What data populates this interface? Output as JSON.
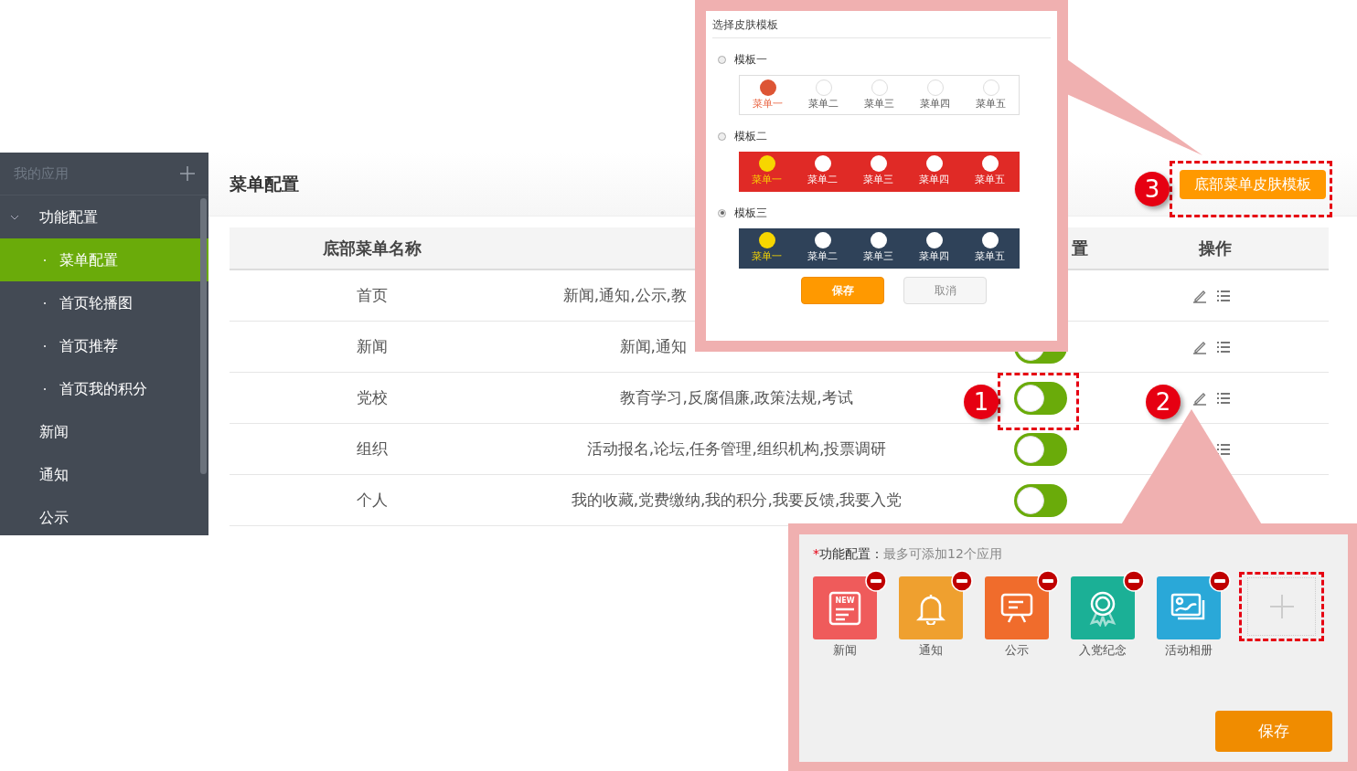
{
  "sidebar": {
    "header": "我的应用",
    "items": [
      {
        "label": "功能配置",
        "expanded": true,
        "children": [
          {
            "label": "菜单配置",
            "selected": true
          },
          {
            "label": "首页轮播图",
            "selected": false
          },
          {
            "label": "首页推荐",
            "selected": false
          },
          {
            "label": "首页我的积分",
            "selected": false
          }
        ]
      },
      {
        "label": "新闻",
        "selected": false
      },
      {
        "label": "通知",
        "selected": false
      },
      {
        "label": "公示",
        "selected": false
      }
    ]
  },
  "page": {
    "title": "菜单配置",
    "skin_button": "底部菜单皮肤模板"
  },
  "table": {
    "columns": [
      "底部菜单名称",
      "置",
      "操作"
    ],
    "rows": [
      {
        "name": "首页",
        "apps": "新闻,通知,公示,教"
      },
      {
        "name": "新闻",
        "apps": "新闻,通知",
        "on": false
      },
      {
        "name": "党校",
        "apps": "教育学习,反腐倡廉,政策法规,考试",
        "on": false
      },
      {
        "name": "组织",
        "apps": "活动报名,论坛,任务管理,组织机构,投票调研",
        "on": false
      },
      {
        "name": "个人",
        "apps": "我的收藏,党费缴纳,我的积分,我要反馈,我要入党",
        "on": false
      }
    ]
  },
  "callouts": [
    "1",
    "2",
    "3"
  ],
  "skin_dialog": {
    "title": "选择皮肤模板",
    "templates": [
      {
        "label": "模板一",
        "selected": false,
        "kind": "plain",
        "items": [
          {
            "label": "菜单一",
            "selected": true
          },
          {
            "label": "菜单二",
            "selected": false
          },
          {
            "label": "菜单三",
            "selected": false
          },
          {
            "label": "菜单四",
            "selected": false
          },
          {
            "label": "菜单五",
            "selected": false
          }
        ]
      },
      {
        "label": "模板二",
        "selected": false,
        "kind": "red",
        "items": [
          {
            "label": "菜单一",
            "selected": true
          },
          {
            "label": "菜单二",
            "selected": false
          },
          {
            "label": "菜单三",
            "selected": false
          },
          {
            "label": "菜单四",
            "selected": false
          },
          {
            "label": "菜单五",
            "selected": false
          }
        ]
      },
      {
        "label": "模板三",
        "selected": true,
        "kind": "navy",
        "items": [
          {
            "label": "菜单一",
            "selected": true
          },
          {
            "label": "菜单二",
            "selected": false
          },
          {
            "label": "菜单三",
            "selected": false
          },
          {
            "label": "菜单四",
            "selected": false
          },
          {
            "label": "菜单五",
            "selected": false
          }
        ]
      }
    ],
    "save": "保存",
    "cancel": "取消"
  },
  "app_panel": {
    "asterisk": "*",
    "label": "功能配置：",
    "hint": "最多可添加12个应用",
    "apps": [
      {
        "label": "新闻",
        "kind": "news",
        "color": "#ef5b5b",
        "icon_text": "NEW"
      },
      {
        "label": "通知",
        "kind": "bell",
        "color": "#efa02f"
      },
      {
        "label": "公示",
        "kind": "board",
        "color": "#f06c2c"
      },
      {
        "label": "入党纪念",
        "kind": "award",
        "color": "#1bb096"
      },
      {
        "label": "活动相册",
        "kind": "photo",
        "color": "#2aa8d8"
      }
    ],
    "save": "保存"
  }
}
